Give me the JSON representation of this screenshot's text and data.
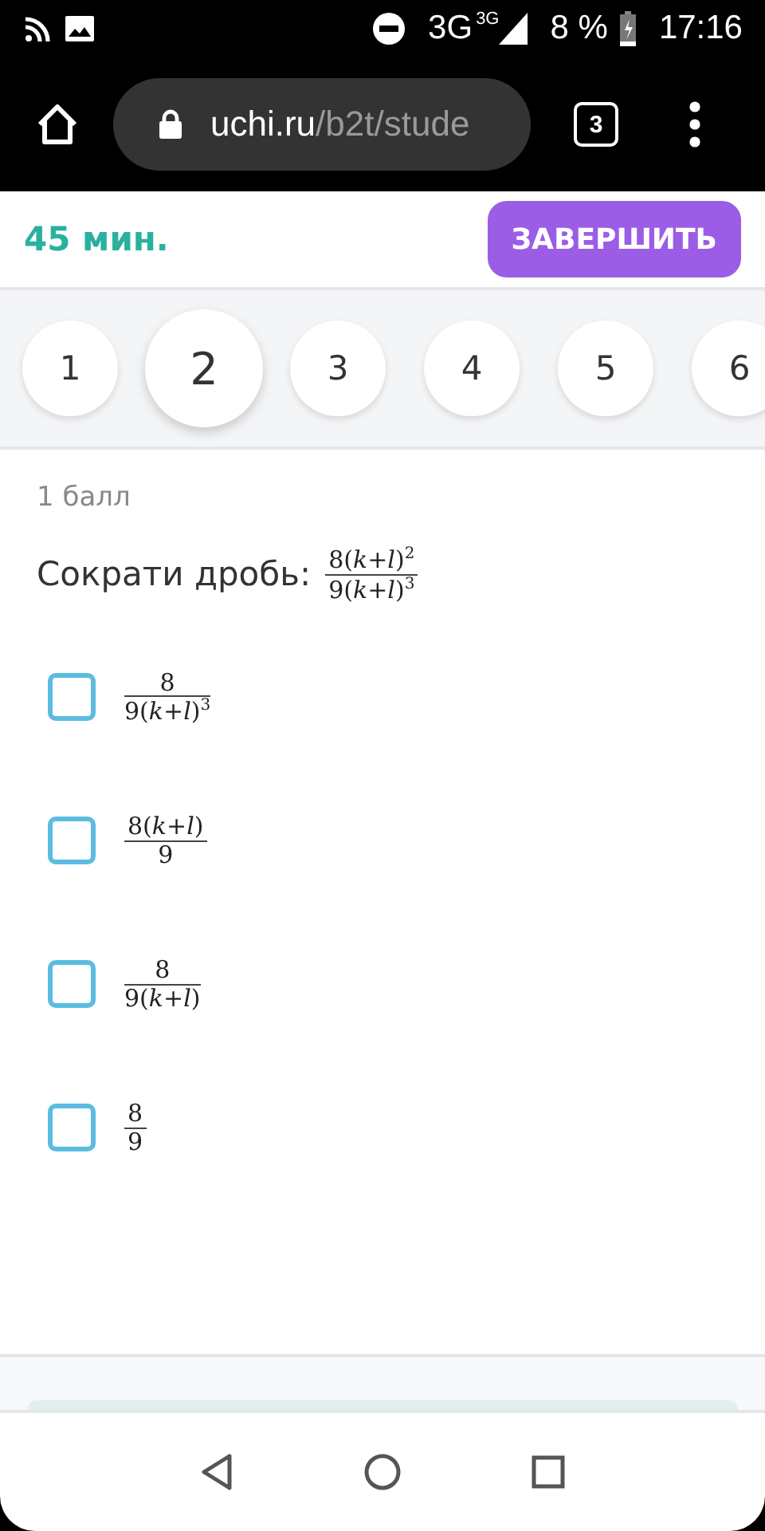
{
  "status_bar": {
    "network": "3G",
    "network_small": "3G",
    "battery": "8 %",
    "time": "17:16"
  },
  "browser": {
    "url_host": "uchi.ru",
    "url_path": "/b2t/stude",
    "tab_count": "3"
  },
  "header": {
    "timer": "45 мин.",
    "finish_button": "ЗАВЕРШИТЬ"
  },
  "questions": [
    {
      "label": "1",
      "selected": false
    },
    {
      "label": "2",
      "selected": true
    },
    {
      "label": "3",
      "selected": false
    },
    {
      "label": "4",
      "selected": false
    },
    {
      "label": "5",
      "selected": false
    },
    {
      "label": "6",
      "selected": false
    }
  ],
  "task": {
    "points": "1 балл",
    "prompt": "Сократи дробь:",
    "numerator": "8(*k*+*l*)$^{2}$",
    "denominator": "9(*k*+*l*)$^{3}$"
  },
  "options": [
    {
      "numerator": "8",
      "denominator": "9(*k*+*l*)$^{3}$",
      "checked": false
    },
    {
      "numerator": "8(*k*+*l*)",
      "denominator": "9",
      "checked": false
    },
    {
      "numerator": "8",
      "denominator": "9(*k*+*l*)",
      "checked": false
    },
    {
      "numerator": "8",
      "denominator": "9",
      "checked": false
    }
  ]
}
